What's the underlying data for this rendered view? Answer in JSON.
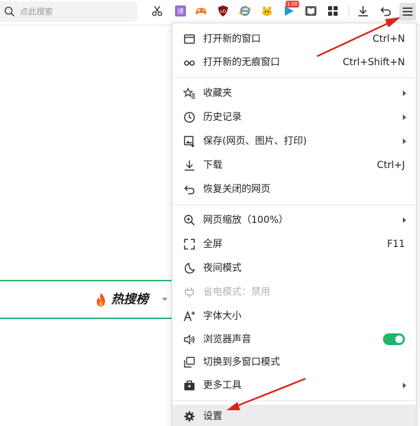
{
  "toolbar": {
    "search_placeholder": "点此搜索",
    "badge_text": "1.00",
    "icons": [
      "search-icon",
      "scissors-icon",
      "translate-icon",
      "gamepad-icon",
      "ublock-icon",
      "ie-icon",
      "pet-icon",
      "play-icon",
      "reader-icon",
      "apps-grid-icon",
      "download-icon",
      "undo-icon",
      "menu-icon"
    ]
  },
  "page": {
    "hot_title": "热搜榜"
  },
  "menu": {
    "items": [
      {
        "label": "打开新的窗口",
        "shortcut": "Ctrl+N",
        "icon": "new-window-icon"
      },
      {
        "label": "打开新的无痕窗口",
        "shortcut": "Ctrl+Shift+N",
        "icon": "incognito-icon"
      },
      {
        "label": "收藏夹",
        "icon": "star-list-icon"
      },
      {
        "label": "历史记录",
        "icon": "clock-icon"
      },
      {
        "label": "保存(网页、图片、打印)",
        "icon": "save-page-icon"
      },
      {
        "label": "下载",
        "shortcut": "Ctrl+J",
        "icon": "download-icon"
      },
      {
        "label": "恢复关闭的网页",
        "icon": "restore-icon"
      },
      {
        "label": "网页缩放（100%）",
        "icon": "zoom-icon"
      },
      {
        "label": "全屏",
        "shortcut": "F11",
        "icon": "fullscreen-icon"
      },
      {
        "label": "夜间模式",
        "icon": "moon-icon"
      },
      {
        "label": "省电模式：禁用",
        "icon": "plug-icon"
      },
      {
        "label": "字体大小",
        "icon": "font-size-icon"
      },
      {
        "label": "浏览器声音",
        "icon": "speaker-icon",
        "toggle_on": true
      },
      {
        "label": "切换到多窗口模式",
        "icon": "multi-window-icon"
      },
      {
        "label": "更多工具",
        "icon": "toolbox-icon"
      },
      {
        "label": "设置",
        "icon": "gear-icon"
      }
    ]
  },
  "colors": {
    "accent_green": "#20b66b",
    "annotation_red": "#d9261c"
  }
}
